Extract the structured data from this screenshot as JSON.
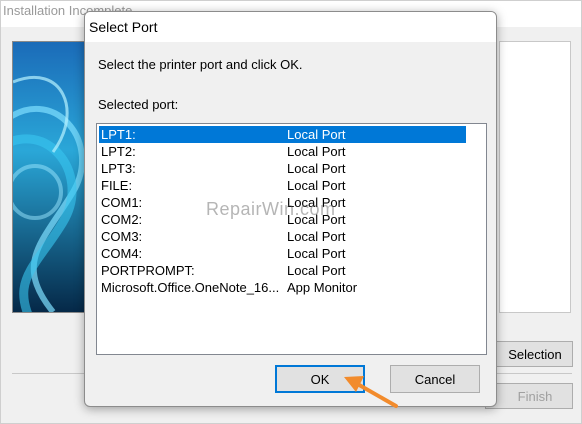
{
  "background_window": {
    "title": "Installation Incomplete",
    "selection_button": "Selection",
    "finish_button": "Finish"
  },
  "dialog": {
    "title": "Select Port",
    "prompt": "Select the printer port and click OK.",
    "port_label": "Selected port:",
    "ports": [
      {
        "name": "LPT1:",
        "description": "Local Port",
        "selected": true
      },
      {
        "name": "LPT2:",
        "description": "Local Port",
        "selected": false
      },
      {
        "name": "LPT3:",
        "description": "Local Port",
        "selected": false
      },
      {
        "name": "FILE:",
        "description": "Local Port",
        "selected": false
      },
      {
        "name": "COM1:",
        "description": "Local Port",
        "selected": false
      },
      {
        "name": "COM2:",
        "description": "Local Port",
        "selected": false
      },
      {
        "name": "COM3:",
        "description": "Local Port",
        "selected": false
      },
      {
        "name": "COM4:",
        "description": "Local Port",
        "selected": false
      },
      {
        "name": "PORTPROMPT:",
        "description": "Local Port",
        "selected": false
      },
      {
        "name": "Microsoft.Office.OneNote_16...",
        "description": "App Monitor",
        "selected": false
      }
    ],
    "ok_button": "OK",
    "cancel_button": "Cancel"
  },
  "watermark": "RepairWin.com",
  "colors": {
    "selection": "#0078d7",
    "arrow": "#f28b2c",
    "dialog_background": "#f0f0f0"
  },
  "icons": {
    "arrow": "pointer-arrow-icon"
  }
}
